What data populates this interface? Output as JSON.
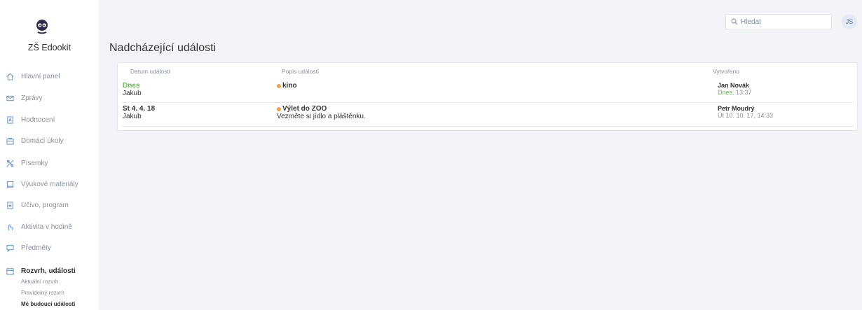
{
  "sidebar": {
    "school_name": "ZŠ Edookit",
    "items": [
      {
        "label": "Hlavní panel",
        "icon": "home-icon"
      },
      {
        "label": "Zprávy",
        "icon": "envelope-icon"
      },
      {
        "label": "Hodnocení",
        "icon": "grade-icon"
      },
      {
        "label": "Domácí úkoly",
        "icon": "homework-icon"
      },
      {
        "label": "Písemky",
        "icon": "tests-icon"
      },
      {
        "label": "Výukové materiály",
        "icon": "materials-icon"
      },
      {
        "label": "Učivo, program",
        "icon": "curriculum-icon"
      },
      {
        "label": "Aktivita v hodině",
        "icon": "hand-icon"
      },
      {
        "label": "Předměty",
        "icon": "subjects-icon"
      },
      {
        "label": "Rozvrh, události",
        "icon": "calendar-icon",
        "active": true
      }
    ],
    "sub_items": [
      {
        "label": "Aktuální rozvrh"
      },
      {
        "label": "Pravidelný rozvrh"
      },
      {
        "label": "Mé budoucí události",
        "active": true
      }
    ]
  },
  "header": {
    "search_placeholder": "Hledat",
    "avatar_initials": "JS"
  },
  "main": {
    "title": "Nadcházející události",
    "table": {
      "columns": [
        "Datum události",
        "Popis události",
        "Vytvořeno"
      ],
      "rows": [
        {
          "date": "Dnes",
          "date_is_today": true,
          "who": "Jakub",
          "event_title": "kino",
          "event_description": "",
          "author": "Jan Novák",
          "created_date": "Dnes",
          "created_time": ", 13:37"
        },
        {
          "date": "St 4. 4. 18",
          "date_is_today": false,
          "who": "Jakub",
          "event_title": "Výlet do ZOO",
          "event_description": "Vezměte si jídlo a pláštěnku.",
          "author": "Petr Moudrý",
          "created_date": "Út 10. 10. 17",
          "created_time": ", 14:33"
        }
      ]
    }
  },
  "colors": {
    "today_green": "#6cba5c",
    "event_dot_orange": "#f0a040",
    "background": "#f3f4f8"
  }
}
